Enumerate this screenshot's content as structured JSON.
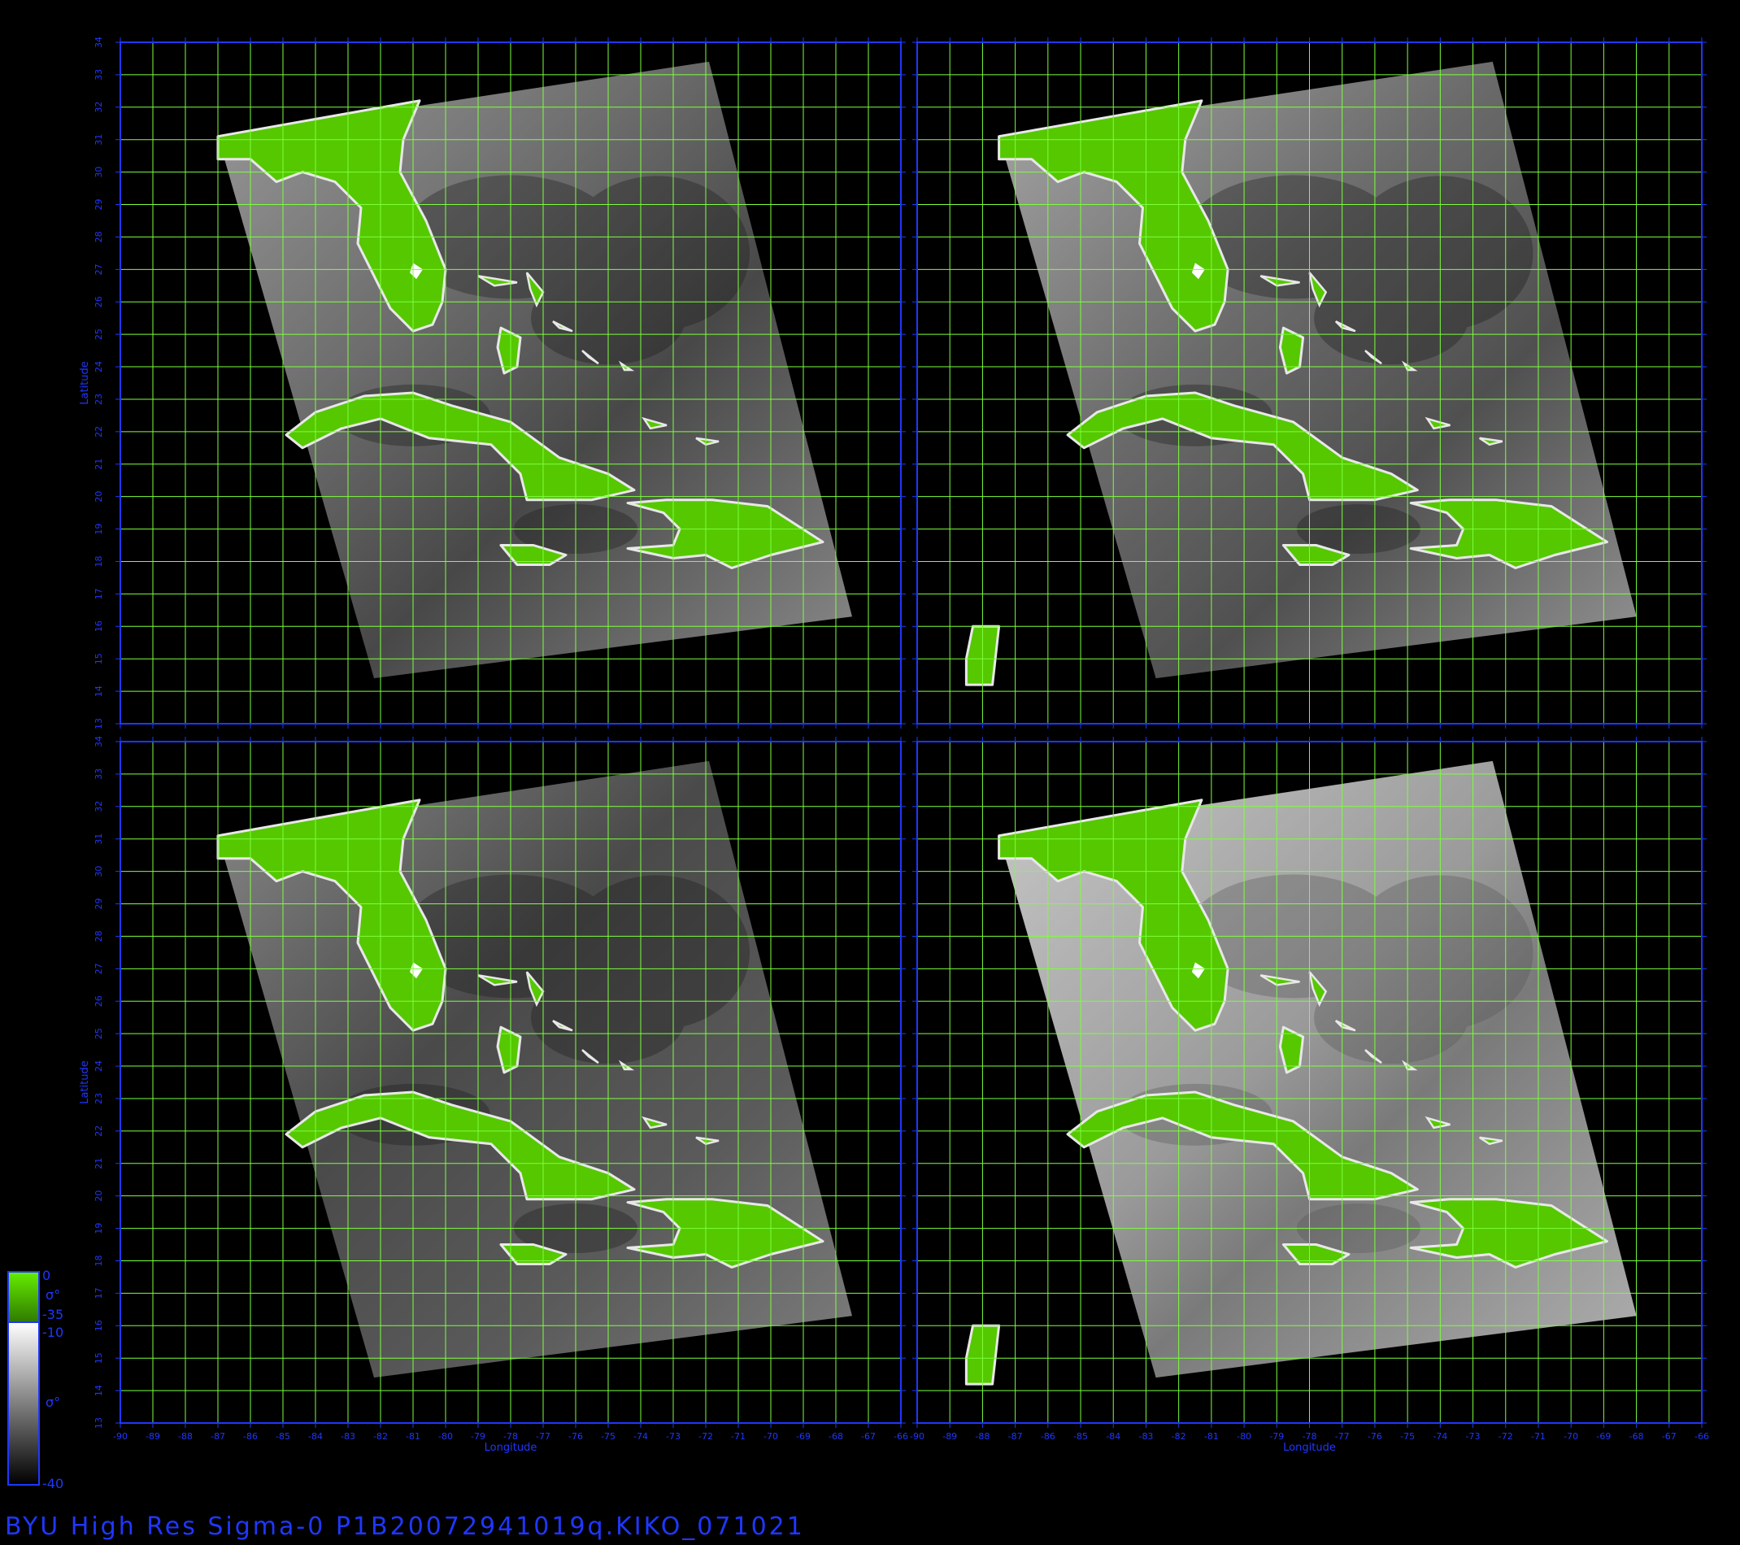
{
  "figure": {
    "footer_title": "BYU  High  Res  Sigma-0  P1B20072941019q.KIKO_071021",
    "grid": {
      "lon_range": [
        -90,
        -66
      ],
      "lat_range": [
        13,
        34
      ],
      "lon_ticks": [
        "-90",
        "-89",
        "-88",
        "-87",
        "-86",
        "-85",
        "-84",
        "-83",
        "-82",
        "-81",
        "-80",
        "-79",
        "-78",
        "-77",
        "-76",
        "-75",
        "-74",
        "-73",
        "-72",
        "-71",
        "-70",
        "-69",
        "-68",
        "-67",
        "-66"
      ],
      "lat_ticks": [
        "13",
        "14",
        "15",
        "16",
        "17",
        "18",
        "19",
        "20",
        "21",
        "22",
        "23",
        "24",
        "25",
        "26",
        "27",
        "28",
        "29",
        "30",
        "31",
        "32",
        "33",
        "34"
      ],
      "xlabel": "Longitude",
      "ylabel": "Latitude"
    },
    "panels": [
      {
        "id": "top-left",
        "tone": "mixed"
      },
      {
        "id": "top-right",
        "tone": "mixed"
      },
      {
        "id": "bottom-left",
        "tone": "dark"
      },
      {
        "id": "bottom-right",
        "tone": "light"
      }
    ],
    "colorbars": {
      "land": {
        "top_label": "0",
        "symbol": "σ°",
        "bottom_label": "-35",
        "color": "#55cc00"
      },
      "ocean": {
        "top_label": "-10",
        "symbol": "σ°",
        "bottom_label": "-40"
      }
    },
    "colors": {
      "frame": "#1f37ff",
      "grid": "#7cff3c",
      "land": "#55c800",
      "background": "#000000"
    }
  }
}
